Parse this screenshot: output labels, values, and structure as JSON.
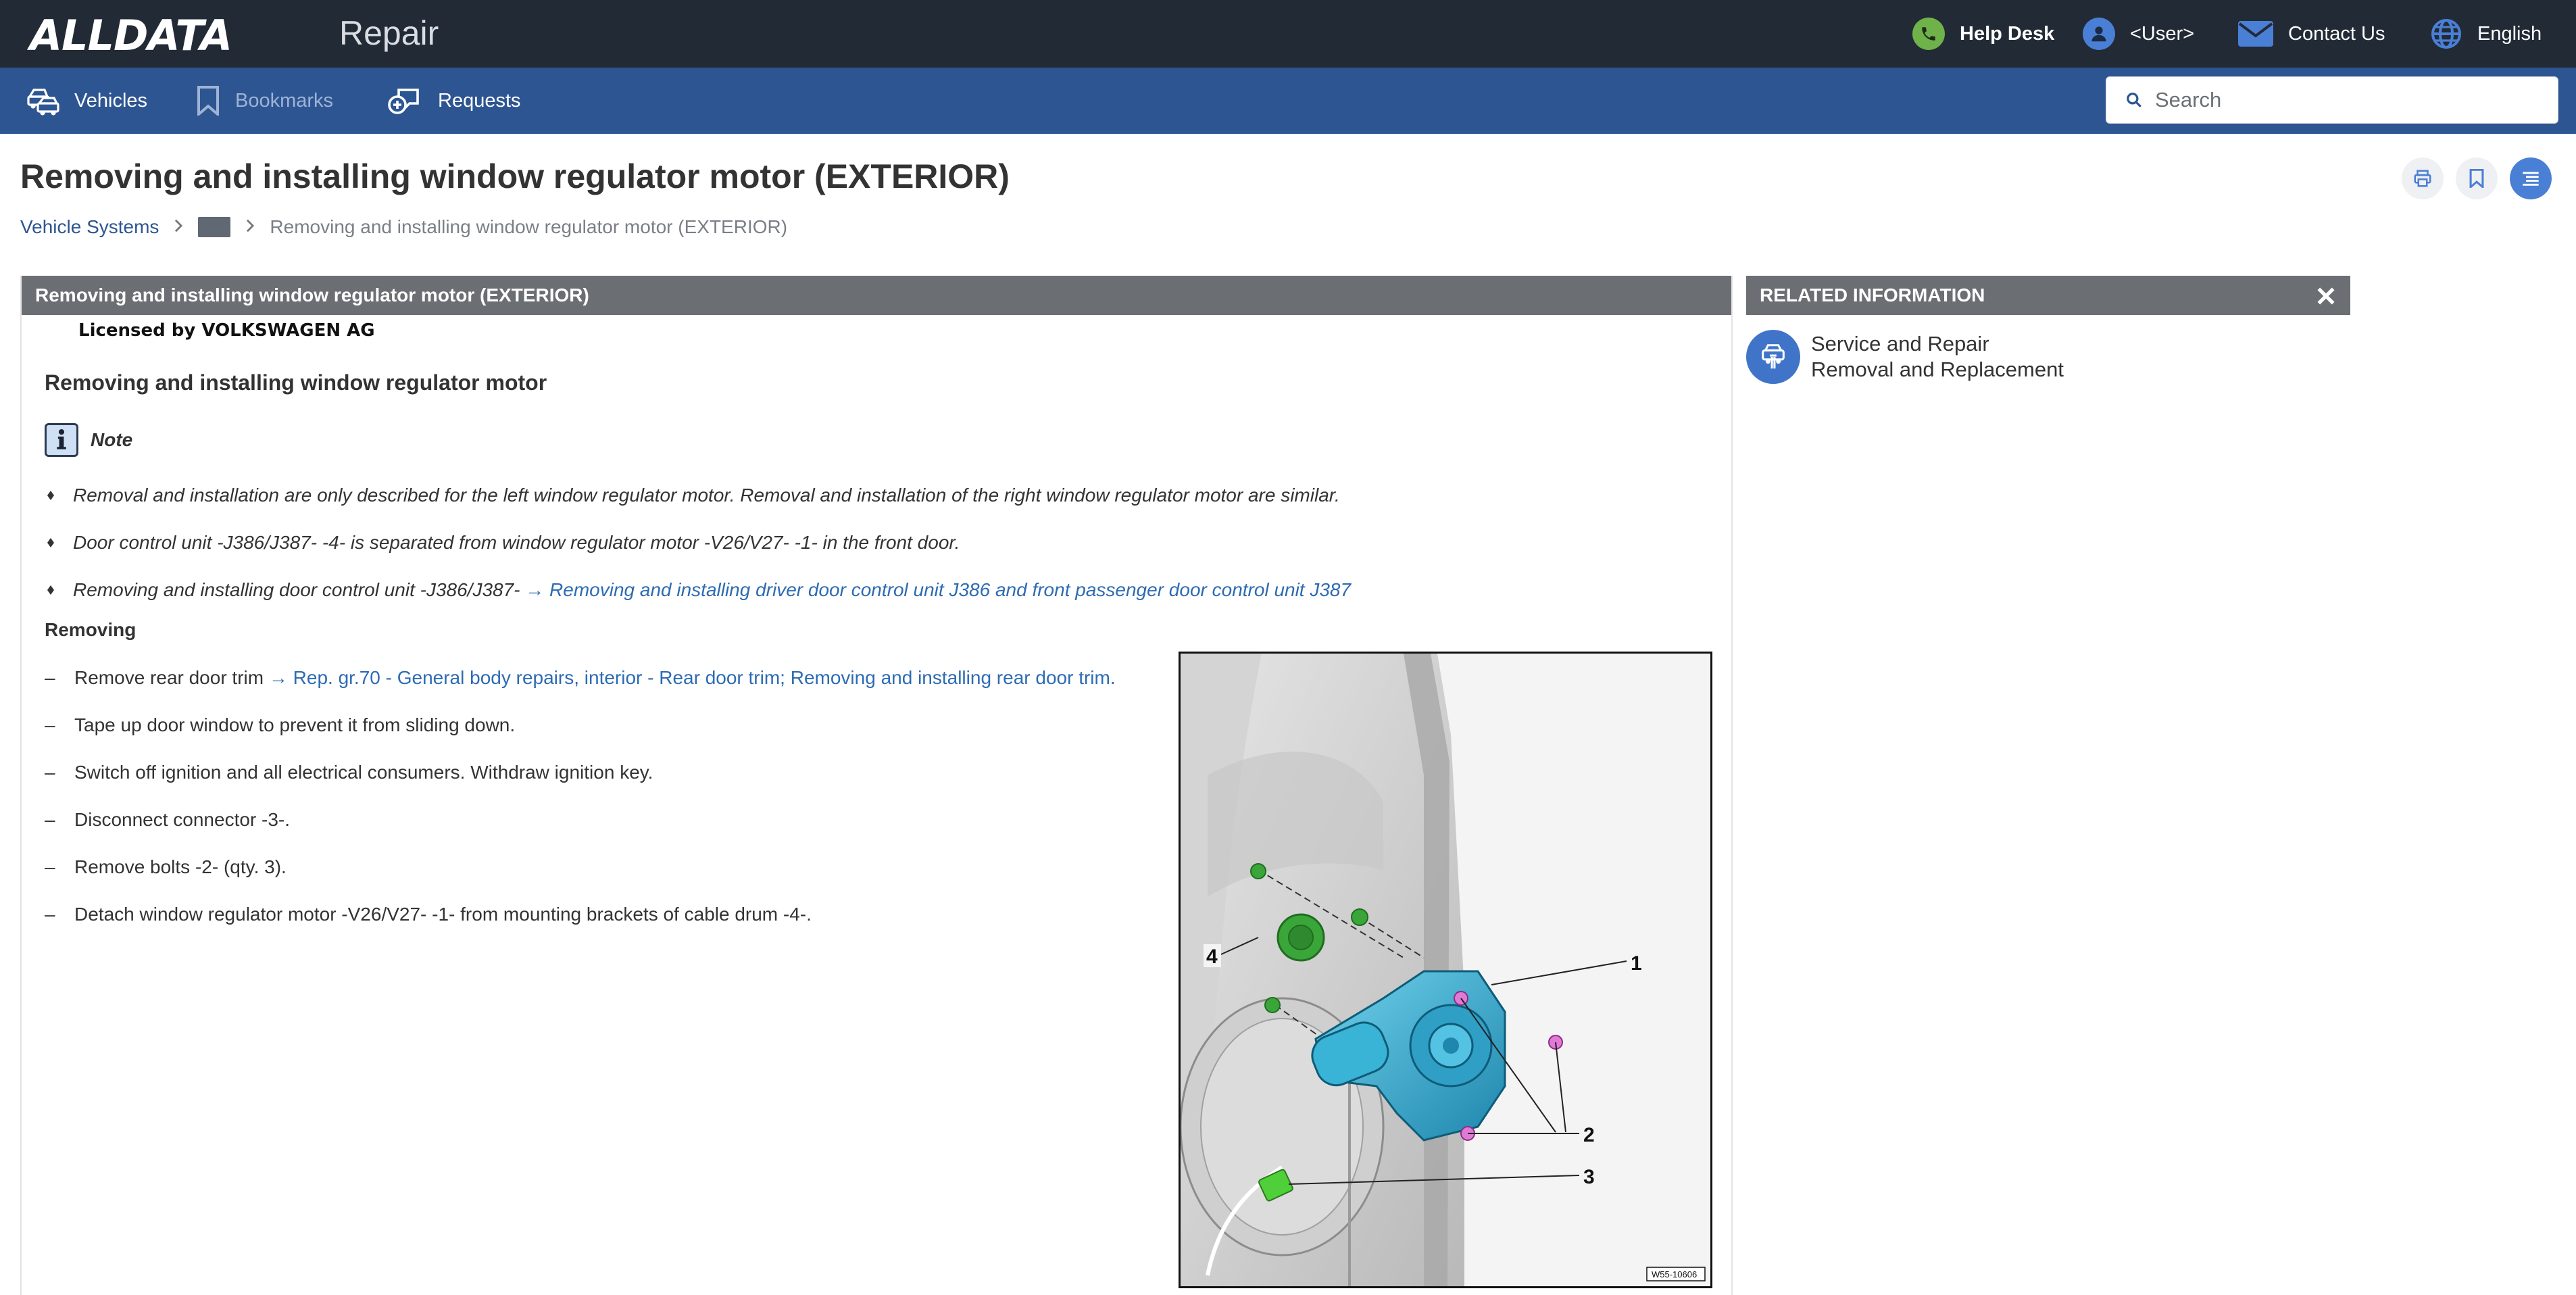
{
  "header": {
    "logo": "ALLDATA",
    "app_name": "Repair",
    "help_desk": "Help Desk",
    "user": "<User>",
    "contact_us": "Contact Us",
    "language": "English"
  },
  "nav": {
    "vehicles": "Vehicles",
    "bookmarks": "Bookmarks",
    "requests": "Requests",
    "search_placeholder": "Search"
  },
  "page": {
    "title": "Removing and installing window regulator motor (EXTERIOR)",
    "breadcrumb": {
      "root": "Vehicle Systems",
      "current": "Removing and installing window regulator motor (EXTERIOR)"
    }
  },
  "article": {
    "header": "Removing and installing window regulator motor (EXTERIOR)",
    "licensed": "Licensed by VOLKSWAGEN AG",
    "section_title": "Removing and installing window regulator motor",
    "note_label": "Note",
    "notes": [
      {
        "text": "Removal and installation are only described for the left window regulator motor. Removal and installation of the right window regulator motor are similar.",
        "link": ""
      },
      {
        "text": "Door control unit -J386/J387- -4- is separated from window regulator motor -V26/V27- -1- in the front door.",
        "link": ""
      },
      {
        "text": "Removing and installing door control unit -J386/J387- ",
        "link": "→ Removing and installing driver door control unit J386 and front passenger door control unit J387"
      }
    ],
    "removing_title": "Removing",
    "steps": [
      {
        "text": "Remove rear door trim ",
        "link": "→ Rep. gr.70 - General body repairs, interior - Rear door trim; Removing and installing rear door trim."
      },
      {
        "text": "Tape up door window to prevent it from sliding down.",
        "link": ""
      },
      {
        "text": "Switch off ignition and all electrical consumers. Withdraw ignition key.",
        "link": ""
      },
      {
        "text": "Disconnect connector -3-.",
        "link": ""
      },
      {
        "text": "Remove bolts -2- (qty. 3).",
        "link": ""
      },
      {
        "text": "Detach window regulator motor -V26/V27- -1- from mounting brackets of cable drum -4-.",
        "link": ""
      }
    ],
    "figure": {
      "callouts": [
        "1",
        "2",
        "3",
        "4"
      ],
      "code": "W55-10606"
    }
  },
  "related": {
    "header": "RELATED INFORMATION",
    "item_line1": "Service and Repair",
    "item_line2": "Removal and Replacement"
  },
  "colors": {
    "topbar": "#222a35",
    "navbar": "#2d5592",
    "panel_header": "#6b6e72",
    "link": "#2d6bb3",
    "motor": "#2aa7cc"
  }
}
